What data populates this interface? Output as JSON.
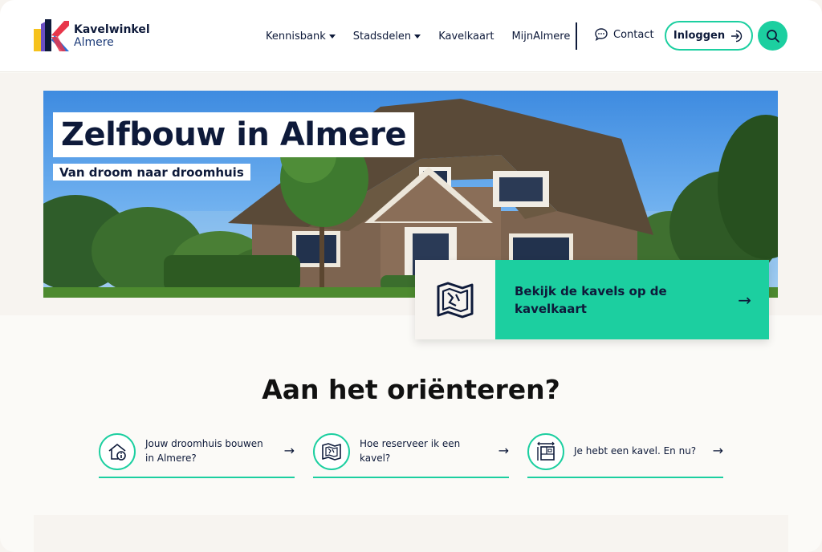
{
  "brand": {
    "name": "Kavelwinkel",
    "sub": "Almere",
    "colors": {
      "navy": "#0e1a3a",
      "teal": "#1ccfa0",
      "yellow": "#f6c21c",
      "blue": "#2a6fd6",
      "purple": "#6b4fc4",
      "red": "#e8364a"
    }
  },
  "nav": {
    "items": [
      {
        "label": "Kennisbank",
        "dropdown": true
      },
      {
        "label": "Stadsdelen",
        "dropdown": true
      },
      {
        "label": "Kavelkaart",
        "dropdown": false
      },
      {
        "label": "MijnAlmere",
        "dropdown": false
      }
    ],
    "contact": "Contact",
    "login": "Inloggen",
    "search_icon": "search-icon"
  },
  "hero": {
    "title": "Zelfbouw in Almere",
    "subtitle": "Van droom naar droomhuis",
    "cta": "Bekijk de kavels op de kavelkaart",
    "cta_icon": "map-icon"
  },
  "section": {
    "title": "Aan het oriënteren?",
    "cards": [
      {
        "label": "Jouw droomhuis bouwen in Almere?",
        "icon": "house-info-icon"
      },
      {
        "label": "Hoe reserveer ik een kavel?",
        "icon": "map-icon"
      },
      {
        "label": "Je hebt een kavel. En nu?",
        "icon": "blueprint-icon"
      }
    ]
  }
}
